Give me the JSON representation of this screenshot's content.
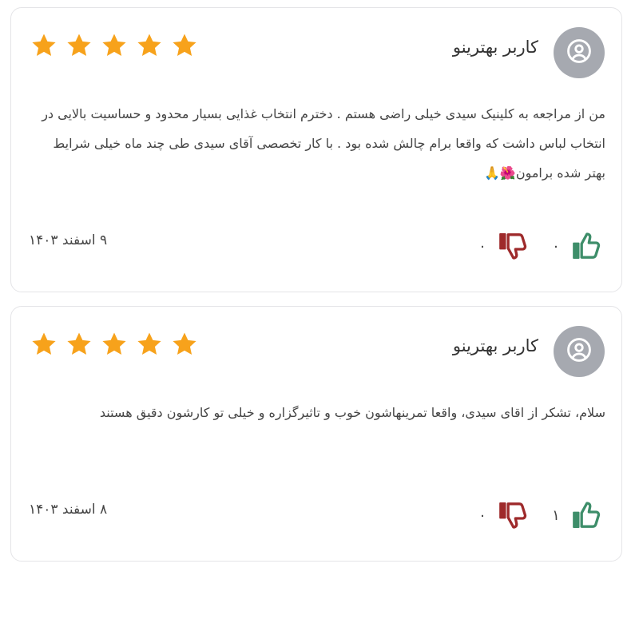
{
  "colors": {
    "star": "#f7a21b",
    "avatar_bg": "#a6a9b0",
    "like": "#3e8e6a",
    "dislike": "#9e2a2b",
    "border": "#e4e4e7"
  },
  "reviews": [
    {
      "user_name": "کاربر بهترینو",
      "rating": 5,
      "text": "من از مراجعه به کلینیک سیدی خیلی راضی هستم . دخترم انتخاب غذایی بسیار محدود و حساسیت بالایی در انتخاب لباس داشت که واقعا برام چالش شده بود . با کار تخصصی آقای سیدی طی چند ماه خیلی شرایط بهتر شده برامون🌺🙏",
      "date": "۹ اسفند ۱۴۰۳",
      "likes": "۰",
      "dislikes": "۰",
      "icons": {
        "avatar": "user-circle-icon",
        "like": "thumbs-up-icon",
        "dislike": "thumbs-down-icon",
        "star": "star-icon"
      }
    },
    {
      "user_name": "کاربر بهترینو",
      "rating": 5,
      "text": "سلام، تشکر از اقای سیدی، واقعا تمرینهاشون خوب و تاثیرگزاره و خیلی تو کارشون دقیق هستند",
      "date": "۸ اسفند ۱۴۰۳",
      "likes": "۱",
      "dislikes": "۰",
      "icons": {
        "avatar": "user-circle-icon",
        "like": "thumbs-up-icon",
        "dislike": "thumbs-down-icon",
        "star": "star-icon"
      }
    }
  ]
}
